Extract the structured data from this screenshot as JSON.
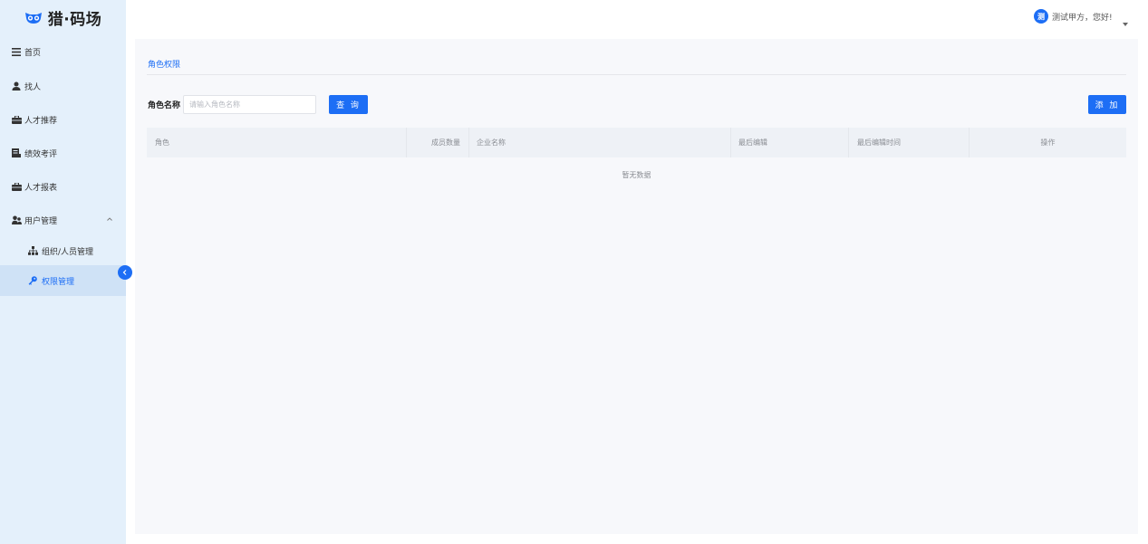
{
  "app": {
    "logo_text": "猎·码场"
  },
  "sidebar": {
    "items": [
      {
        "label": "首页",
        "icon": "menu-icon"
      },
      {
        "label": "找人",
        "icon": "person-icon"
      },
      {
        "label": "人才推荐",
        "icon": "briefcase-icon"
      },
      {
        "label": "绩效考评",
        "icon": "chart-icon"
      },
      {
        "label": "人才报表",
        "icon": "briefcase-icon"
      },
      {
        "label": "用户管理",
        "icon": "users-icon",
        "expanded": true
      },
      {
        "label": "组织/人员管理",
        "icon": "org-tree-icon"
      },
      {
        "label": "权限管理",
        "icon": "key-icon",
        "active": true
      }
    ]
  },
  "header": {
    "avatar_text": "测",
    "greeting": "测试甲方，您好!"
  },
  "page": {
    "breadcrumb": "角色权限",
    "filter": {
      "label": "角色名称",
      "placeholder": "请输入角色名称",
      "value": ""
    },
    "query_label": "查 询",
    "add_label": "添 加",
    "table": {
      "columns": [
        "角色",
        "成员数量",
        "企业名称",
        "最后编辑",
        "最后编辑时间",
        "操作"
      ],
      "rows": [],
      "empty_text": "暂无数据"
    }
  },
  "colors": {
    "accent": "#1d6ef5",
    "sidebar_bg": "#e4f0fb",
    "sidebar_active_bg": "#cfe2f6",
    "content_bg": "#f7f8fb",
    "table_header_bg": "#eef1f6"
  }
}
